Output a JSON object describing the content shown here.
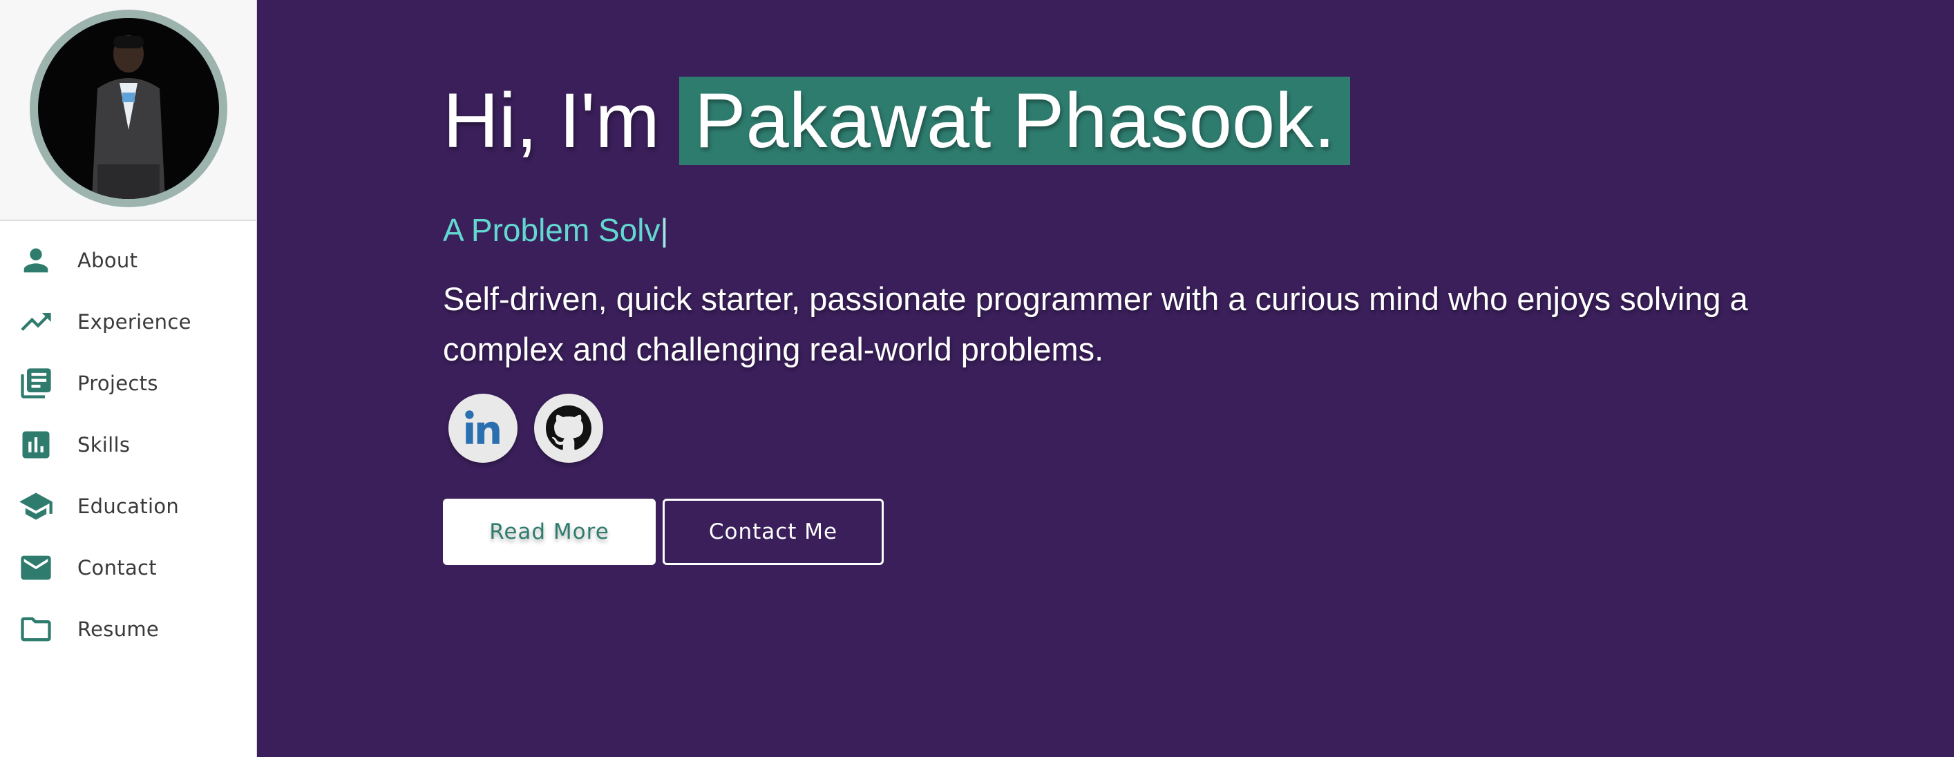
{
  "profile": {
    "avatar_alt": "Profile photo"
  },
  "sidebar": {
    "items": [
      {
        "label": "About",
        "icon": "person-icon"
      },
      {
        "label": "Experience",
        "icon": "trending-up-icon"
      },
      {
        "label": "Projects",
        "icon": "library-books-icon"
      },
      {
        "label": "Skills",
        "icon": "bar-chart-icon"
      },
      {
        "label": "Education",
        "icon": "school-icon"
      },
      {
        "label": "Contact",
        "icon": "mail-icon"
      },
      {
        "label": "Resume",
        "icon": "folder-icon"
      }
    ]
  },
  "hero": {
    "greeting": "Hi, I'm",
    "name": "Pakawat Phasook.",
    "tagline": "A Problem Solv",
    "cursor": "|",
    "bio": "Self-driven, quick starter, passionate programmer with a curious mind who enjoys solving a complex and challenging real-world problems.",
    "socials": [
      {
        "name": "linkedin",
        "icon": "linkedin-icon"
      },
      {
        "name": "github",
        "icon": "github-icon"
      }
    ],
    "read_more_label": "Read More",
    "contact_label": "Contact Me"
  },
  "colors": {
    "accent": "#2e7c6e",
    "background": "#3a1f5a",
    "tagline": "#63d8d0",
    "sidebar_icon": "#2f7c6e"
  }
}
